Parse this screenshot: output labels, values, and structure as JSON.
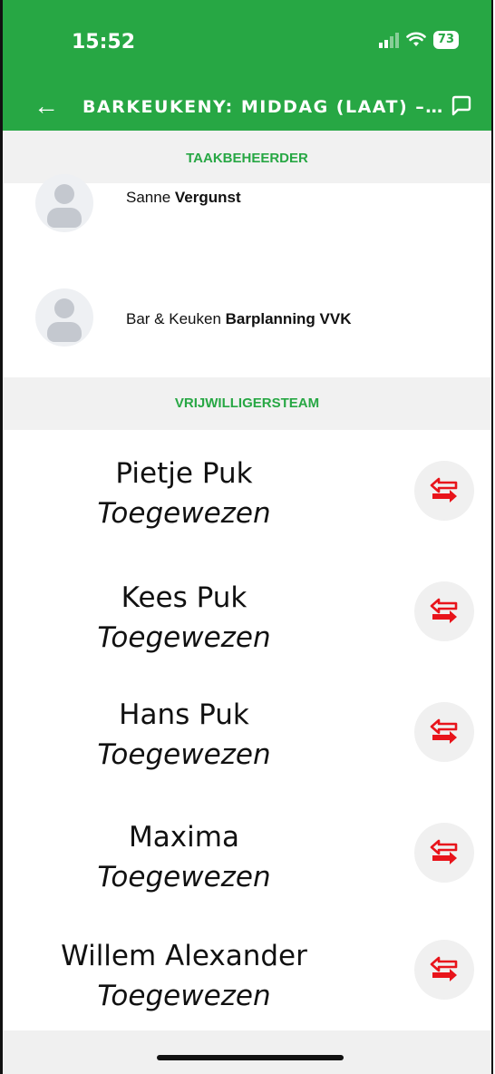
{
  "status_bar": {
    "time": "15:52",
    "battery": "73"
  },
  "app_bar": {
    "title": "BARKEUKENY: MIDDAG (LAAT) –…"
  },
  "manager_section": {
    "header": "TAAKBEHEERDER",
    "people": [
      {
        "first": "Sanne",
        "last": "Vergunst"
      },
      {
        "first": "Bar & Keuken",
        "last": "Barplanning VVK"
      }
    ]
  },
  "volunteer_section": {
    "header": "VRIJWILLIGERSTEAM",
    "members": [
      {
        "name": "Pietje Puk",
        "status": "Toegewezen"
      },
      {
        "name": "Kees Puk",
        "status": "Toegewezen"
      },
      {
        "name": "Hans Puk",
        "status": "Toegewezen"
      },
      {
        "name": "Maxima",
        "status": "Toegewezen"
      },
      {
        "name": "Willem Alexander",
        "status": "Toegewezen"
      }
    ]
  },
  "colors": {
    "brand_green": "#27a744",
    "swap_red": "#e8141b"
  },
  "icons": {
    "back": "arrow-left-icon",
    "chat": "chat-bubble-icon",
    "swap": "swap-arrows-icon",
    "avatar": "person-placeholder-icon"
  }
}
